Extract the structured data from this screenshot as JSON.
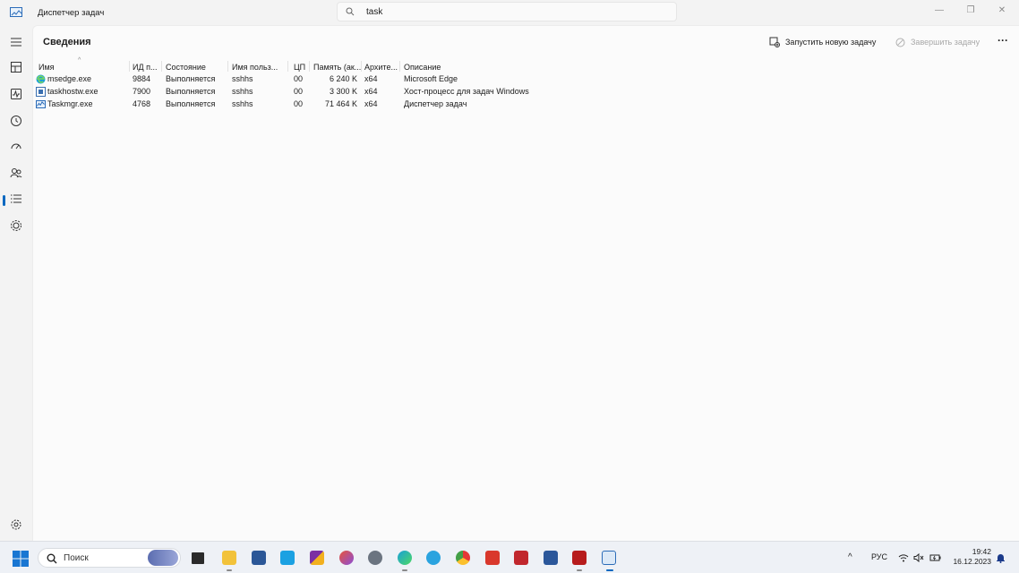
{
  "window": {
    "title": "Диспетчер задач",
    "search_value": "task",
    "minimize": "—",
    "restore": "❐",
    "close": "✕"
  },
  "nav": {
    "items": [
      "menu-icon",
      "processes-icon",
      "performance-icon",
      "app-history-icon",
      "startup-apps-icon",
      "users-icon",
      "details-icon",
      "services-icon",
      "settings-icon"
    ],
    "active": "details-icon"
  },
  "page": {
    "title": "Сведения",
    "run_new_task": "Запустить новую задачу",
    "end_task": "Завершить задачу",
    "more": "···"
  },
  "table": {
    "headers": {
      "name": "Имя",
      "pid": "ИД п...",
      "status": "Состояние",
      "user": "Имя польз...",
      "cpu": "ЦП",
      "memory": "Память (ак...",
      "arch": "Архите...",
      "description": "Описание"
    },
    "rows": [
      {
        "icon": "edge-icon",
        "name": "msedge.exe",
        "pid": "9884",
        "status": "Выполняется",
        "user": "sshhs",
        "cpu": "00",
        "memory": "6 240 K",
        "arch": "x64",
        "description": "Microsoft Edge"
      },
      {
        "icon": "taskhost-icon",
        "name": "taskhostw.exe",
        "pid": "7900",
        "status": "Выполняется",
        "user": "sshhs",
        "cpu": "00",
        "memory": "3 300 K",
        "arch": "x64",
        "description": "Хост-процесс для задач Windows"
      },
      {
        "icon": "taskmgr-icon",
        "name": "Taskmgr.exe",
        "pid": "4768",
        "status": "Выполняется",
        "user": "sshhs",
        "cpu": "00",
        "memory": "71 464 K",
        "arch": "x64",
        "description": "Диспетчер задач"
      }
    ]
  },
  "taskbar": {
    "search_placeholder": "Поиск",
    "apps": [
      "task-view-icon",
      "file-explorer-icon",
      "store-icon",
      "app-store-icon",
      "winrar-icon",
      "firefox-icon",
      "settings-icon",
      "edge-icon",
      "telegram-icon",
      "chrome-icon",
      "app-red-icon",
      "access-icon",
      "word-icon",
      "aida64-icon",
      "task-manager-icon"
    ],
    "language": "РУС",
    "time": "19:42",
    "date": "16.12.2023"
  },
  "colors": {
    "accent": "#0067c0",
    "background": "#f3f3f3",
    "content_bg": "#fbfbfb"
  }
}
